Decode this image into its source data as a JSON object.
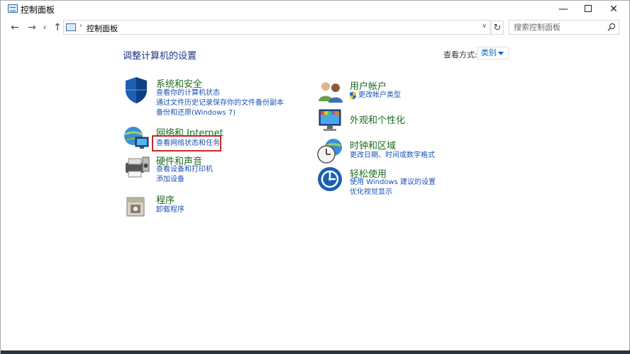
{
  "window": {
    "title": "控制面板",
    "minimize_glyph": "—",
    "close_glyph": "✕"
  },
  "nav": {
    "back_glyph": "←",
    "forward_glyph": "→",
    "recent_glyph": "∨",
    "up_glyph": "↑",
    "address_separator": "›",
    "address_text": "控制面板",
    "address_dropdown_glyph": "∨",
    "refresh_glyph": "↻",
    "search_placeholder": "搜索控制面板"
  },
  "content": {
    "heading": "调整计算机的设置",
    "view_by_label": "查看方式:",
    "view_by_value": "类别"
  },
  "categories_left": [
    {
      "title": "系统和安全",
      "icon": "shield-icon",
      "links": [
        "查看你的计算机状态",
        "通过文件历史记录保存你的文件备份副本",
        "备份和还原(Windows 7)"
      ]
    },
    {
      "title": "网络和 Internet",
      "icon": "network-globe-icon",
      "links": [
        "查看网络状态和任务"
      ]
    },
    {
      "title": "硬件和声音",
      "icon": "printer-speaker-icon",
      "links": [
        "查看设备和打印机",
        "添加设备"
      ]
    },
    {
      "title": "程序",
      "icon": "programs-box-icon",
      "links": [
        "卸载程序"
      ]
    }
  ],
  "categories_right": [
    {
      "title": "用户帐户",
      "icon": "users-icon",
      "links": [
        "更改帐户类型"
      ]
    },
    {
      "title": "外观和个性化",
      "icon": "monitor-personalization-icon",
      "links": []
    },
    {
      "title": "时钟和区域",
      "icon": "clock-globe-icon",
      "links": [
        "更改日期、时间或数字格式"
      ]
    },
    {
      "title": "轻松使用",
      "icon": "ease-of-access-icon",
      "links": [
        "使用 Windows 建议的设置",
        "优化视觉显示"
      ]
    }
  ],
  "colors": {
    "heading": "#1e3287",
    "category_title": "#1e6b1e",
    "link": "#1c52b8",
    "highlight_border": "#c62828"
  }
}
